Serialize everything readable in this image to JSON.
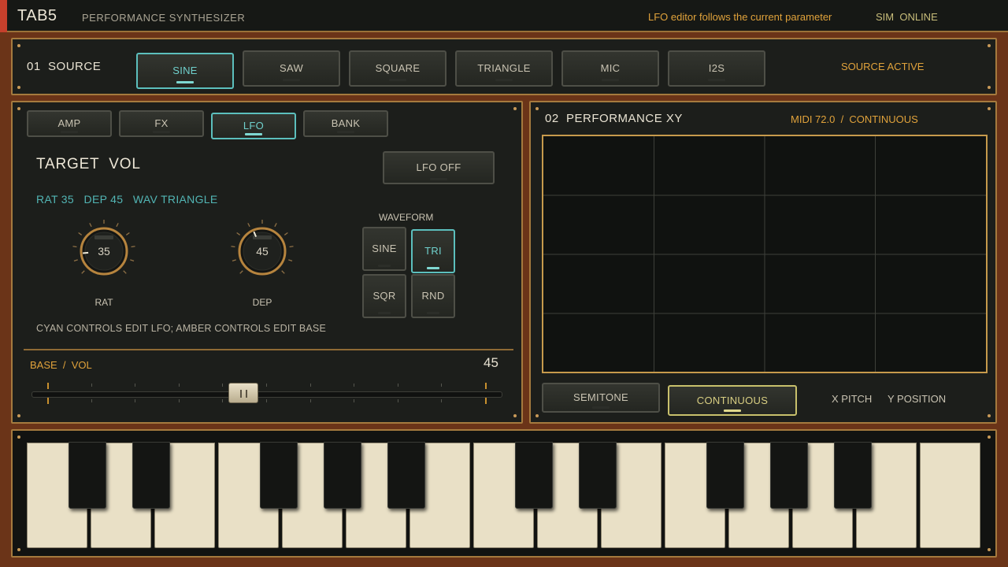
{
  "header": {
    "app_title": "TAB5",
    "app_subtitle": "PERFORMANCE SYNTHESIZER",
    "hint": "LFO editor follows the current parameter",
    "status": "SIM  ONLINE"
  },
  "source": {
    "title": "01  SOURCE",
    "buttons": [
      "SINE",
      "SAW",
      "SQUARE",
      "TRIANGLE",
      "MIC",
      "I2S"
    ],
    "selected": "SINE",
    "status": "SOURCE ACTIVE"
  },
  "editor": {
    "tabs": [
      "AMP",
      "FX",
      "LFO",
      "BANK"
    ],
    "selected_tab": "LFO",
    "target": "TARGET  VOL",
    "lfo_toggle": "LFO OFF",
    "params_line": "RAT 35   DEP 45   WAV TRIANGLE",
    "knobs": [
      {
        "label": "RAT",
        "value": "35",
        "level": 0.35
      },
      {
        "label": "DEP",
        "value": "45",
        "level": 0.45
      }
    ],
    "waveform": {
      "title": "WAVEFORM",
      "buttons": [
        "SINE",
        "TRI",
        "SQR",
        "RND"
      ],
      "selected": "TRI"
    },
    "note": "CYAN CONTROLS EDIT LFO; AMBER CONTROLS EDIT BASE",
    "base": {
      "label": "BASE  /  VOL",
      "value": "45",
      "level": 0.45
    }
  },
  "xy": {
    "title": "02  PERFORMANCE XY",
    "midi_status": "MIDI 72.0  /  CONTINUOUS",
    "modes": [
      "SEMITONE",
      "CONTINUOUS"
    ],
    "selected_mode": "CONTINUOUS",
    "x_axis": "X PITCH",
    "y_axis": "Y POSITION"
  },
  "colors": {
    "accent_amber": "#e0a23b",
    "accent_cyan": "#5cbfbd",
    "accent_yellow": "#c8c06c",
    "panel_bg": "#1c1e1b",
    "frame_bg": "#6b3418"
  }
}
